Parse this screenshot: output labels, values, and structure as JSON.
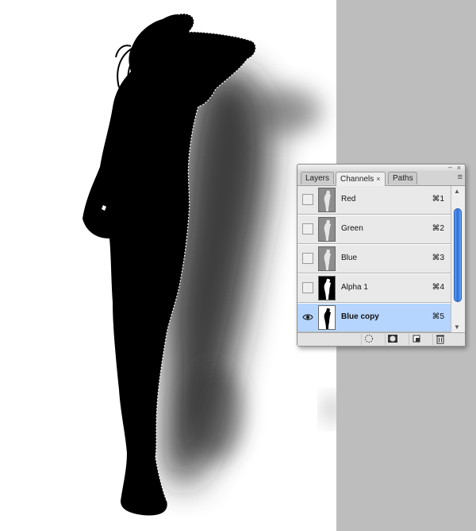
{
  "palette": {
    "tabs": [
      {
        "label": "Layers",
        "active": false
      },
      {
        "label": "Channels",
        "active": true,
        "close": "×"
      },
      {
        "label": "Paths",
        "active": false
      }
    ],
    "window_close": "×",
    "window_min": "–",
    "menu_glyph": "≡",
    "channels": [
      {
        "name": "Red",
        "shortcut": "⌘1",
        "visible": false,
        "selected": false
      },
      {
        "name": "Green",
        "shortcut": "⌘2",
        "visible": false,
        "selected": false
      },
      {
        "name": "Blue",
        "shortcut": "⌘3",
        "visible": false,
        "selected": false
      },
      {
        "name": "Alpha 1",
        "shortcut": "⌘4",
        "visible": false,
        "selected": false
      },
      {
        "name": "Blue copy",
        "shortcut": "⌘5",
        "visible": true,
        "selected": true
      }
    ],
    "footer_icons": [
      "dotted-circle-icon",
      "mask-icon",
      "new-channel-icon",
      "trash-icon"
    ],
    "scroll_up": "▲",
    "scroll_down": "▼"
  },
  "colors": {
    "pasteboard": "#bdbdbd",
    "selected_row": "#b5d5ff",
    "scrollbar": "#2c6fd6"
  }
}
